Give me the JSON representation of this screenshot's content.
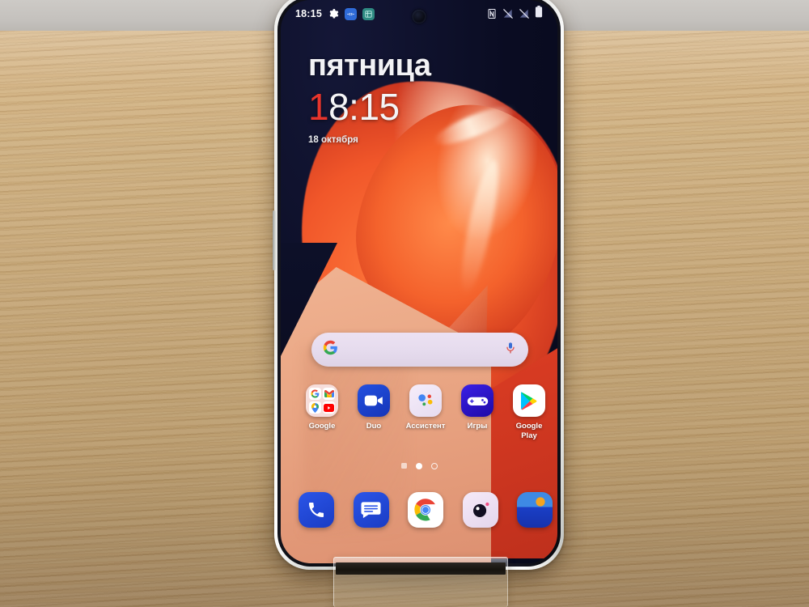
{
  "scene": {
    "description": "Smartphone on wooden desk in acrylic stand",
    "wall_color": "#c6c3bf",
    "desk_color": "#c8a775"
  },
  "phone": {
    "frame_color": "#e8e9e6",
    "screen_bg": "#0a0c22",
    "camera": "punch-hole-camera"
  },
  "status_bar": {
    "time": "18:15",
    "left_icons": [
      {
        "name": "gear-icon",
        "label": "settings"
      },
      {
        "name": "vpn-icon",
        "label": "vpn",
        "color": "#2f6bd8"
      },
      {
        "name": "app-badge-icon",
        "label": "notification",
        "color": "#2e8a82"
      }
    ],
    "right_icons": [
      {
        "name": "nfc-icon",
        "label": "NFC"
      },
      {
        "name": "signal-off-icon",
        "label": "sim1-no-signal"
      },
      {
        "name": "signal-off-icon",
        "label": "sim2-no-signal"
      },
      {
        "name": "battery-icon",
        "label": "battery-full"
      }
    ]
  },
  "clock_widget": {
    "weekday": "пятница",
    "time_red_prefix": "1",
    "time_rest": "8:15",
    "date": "18 октября"
  },
  "search_bar": {
    "left_icon": "google-g-icon",
    "right_icon": "microphone-icon",
    "placeholder": "",
    "bg_color": "#e6dcee"
  },
  "app_grid": [
    {
      "label": "Google",
      "type": "folder",
      "icon_name": "google-folder-icon",
      "mini_icons": [
        "google-g-icon",
        "gmail-icon",
        "maps-pin-icon",
        "youtube-icon"
      ]
    },
    {
      "label": "Duo",
      "type": "app",
      "icon_name": "duo-icon",
      "color": "#1c43c8"
    },
    {
      "label": "Ассистент",
      "type": "app",
      "icon_name": "google-assistant-icon",
      "color": "#efe6f6"
    },
    {
      "label": "Игры",
      "type": "app",
      "icon_name": "games-gamepad-icon",
      "color": "#2712c8"
    },
    {
      "label": "Google\nPlay",
      "type": "app",
      "icon_name": "google-play-icon",
      "color": "#ffffff"
    }
  ],
  "page_indicator": {
    "dots": [
      "square",
      "active",
      "inactive"
    ],
    "current_page": 2,
    "total_pages": 3
  },
  "dock": [
    {
      "label": "Phone",
      "icon_name": "phone-icon",
      "color": "#2145d6"
    },
    {
      "label": "Messages",
      "icon_name": "messages-icon",
      "color": "#2145d6"
    },
    {
      "label": "Chrome",
      "icon_name": "chrome-icon",
      "color": "#ffffff"
    },
    {
      "label": "Camera",
      "icon_name": "camera-icon",
      "color": "#efe3f2"
    },
    {
      "label": "Gallery",
      "icon_name": "gallery-icon",
      "color": "#1e4fd0"
    }
  ],
  "stand": {
    "name": "acrylic-display-stand"
  },
  "colors": {
    "accent_red": "#e8352c",
    "wallpaper_orange": "#f1572a",
    "wallpaper_peach": "#eaa785",
    "wallpaper_navy": "#0a0c22"
  }
}
